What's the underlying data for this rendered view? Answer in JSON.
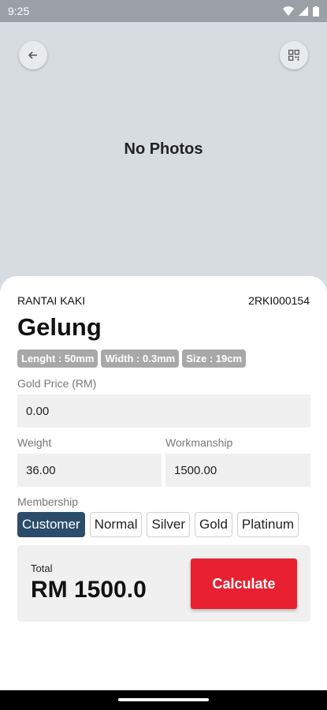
{
  "status_bar": {
    "time": "9:25"
  },
  "photo": {
    "empty_text": "No Photos"
  },
  "product": {
    "category": "RANTAI KAKI",
    "code": "2RKI000154",
    "title": "Gelung",
    "specs": [
      "Lenght : 50mm",
      "Width : 0.3mm",
      "Size : 19cm"
    ]
  },
  "form": {
    "gold_price_label": "Gold Price (RM)",
    "gold_price_value": "0.00",
    "weight_label": "Weight",
    "weight_value": "36.00",
    "workmanship_label": "Workmanship",
    "workmanship_value": "1500.00",
    "membership_label": "Membership",
    "membership_options": [
      "Customer",
      "Normal",
      "Silver",
      "Gold",
      "Platinum"
    ],
    "membership_selected": "Customer"
  },
  "summary": {
    "total_label": "Total",
    "total_value": "RM 1500.0",
    "calculate_label": "Calculate"
  },
  "colors": {
    "accent_red": "#e8202f",
    "selected_navy": "#2b4d6b"
  }
}
